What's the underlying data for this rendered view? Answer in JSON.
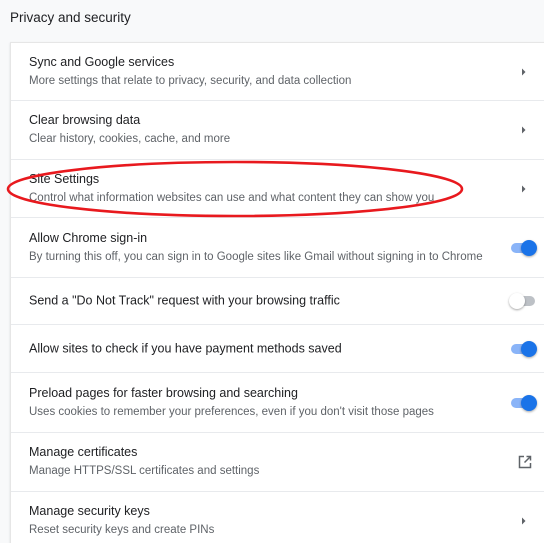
{
  "section": {
    "title": "Privacy and security"
  },
  "rows": [
    {
      "title": "Sync and Google services",
      "subtitle": "More settings that relate to privacy, security, and data collection",
      "control": "chevron"
    },
    {
      "title": "Clear browsing data",
      "subtitle": "Clear history, cookies, cache, and more",
      "control": "chevron"
    },
    {
      "title": "Site Settings",
      "subtitle": "Control what information websites can use and what content they can show you",
      "control": "chevron"
    },
    {
      "title": "Allow Chrome sign-in",
      "subtitle": "By turning this off, you can sign in to Google sites like Gmail without signing in to Chrome",
      "control": "toggle",
      "toggle_on": true
    },
    {
      "title": "Send a \"Do Not Track\" request with your browsing traffic",
      "subtitle": "",
      "control": "toggle",
      "toggle_on": false
    },
    {
      "title": "Allow sites to check if you have payment methods saved",
      "subtitle": "",
      "control": "toggle",
      "toggle_on": true
    },
    {
      "title": "Preload pages for faster browsing and searching",
      "subtitle": "Uses cookies to remember your preferences, even if you don't visit those pages",
      "control": "toggle",
      "toggle_on": true
    },
    {
      "title": "Manage certificates",
      "subtitle": "Manage HTTPS/SSL certificates and settings",
      "control": "external-link"
    },
    {
      "title": "Manage security keys",
      "subtitle": "Reset security keys and create PINs",
      "control": "chevron"
    }
  ],
  "colors": {
    "accent": "#1a73e8",
    "accent_track": "#8ab4f8",
    "highlight_annotation": "#e8191e"
  },
  "icons": {
    "chevron": "chevron-right-icon",
    "external_link": "open-in-new-icon"
  }
}
